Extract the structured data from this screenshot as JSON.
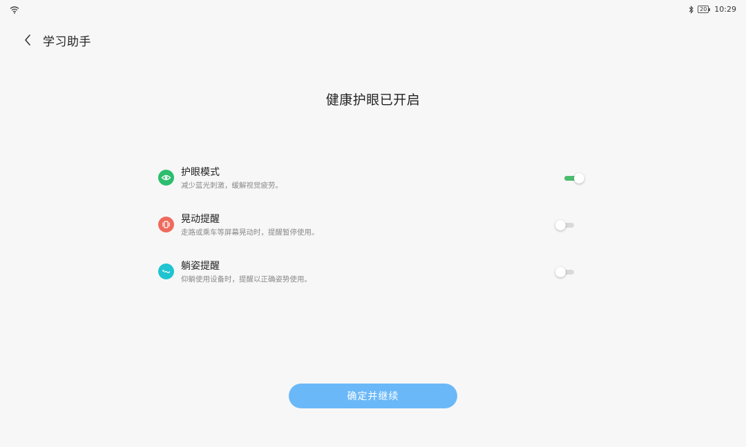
{
  "status_bar": {
    "wifi_icon": "wifi-icon",
    "bluetooth_icon": "bluetooth-icon",
    "battery_level": "20",
    "time": "10:29"
  },
  "header": {
    "back_icon": "chevron-left-icon",
    "title": "学习助手"
  },
  "heading": "健康护眼已开启",
  "settings": [
    {
      "title": "护眼模式",
      "description": "减少蓝光刺激，缓解视觉疲劳。",
      "icon": "eye-icon",
      "icon_color": "#2dbd6e",
      "enabled": true
    },
    {
      "title": "晃动提醒",
      "description": "走路或乘车等屏幕晃动时，提醒暂停使用。",
      "icon": "vibrate-phone-icon",
      "icon_color": "#ee6a5c",
      "enabled": false
    },
    {
      "title": "躺姿提醒",
      "description": "仰躺使用设备时，提醒以正确姿势使用。",
      "icon": "lying-posture-icon",
      "icon_color": "#1fc4d0",
      "enabled": false
    }
  ],
  "confirm_button": {
    "label": "确定并继续",
    "color": "#6ab8f8"
  },
  "colors": {
    "toggle_on": "#4cbd6e",
    "toggle_off": "#d9d9d9",
    "background": "#f7f7f7"
  }
}
